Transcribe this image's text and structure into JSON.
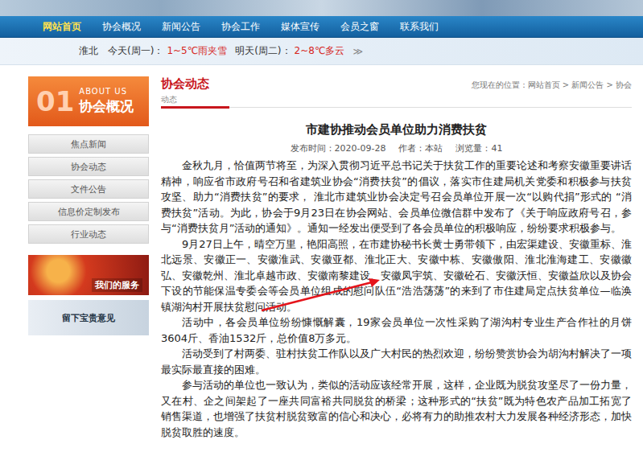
{
  "nav": [
    {
      "label": "网站首页",
      "selected": true
    },
    {
      "label": "协会概况",
      "selected": false
    },
    {
      "label": "新闻公告",
      "selected": false
    },
    {
      "label": "协会工作",
      "selected": false
    },
    {
      "label": "媒体宣传",
      "selected": false
    },
    {
      "label": "会员之窗",
      "selected": false
    },
    {
      "label": "联系我们",
      "selected": false
    }
  ],
  "weather": {
    "city": "淮北",
    "today_label": "今天(周一)：",
    "today": "1~5℃雨夹雪",
    "tomorrow_label": "明天(周二)：",
    "tomorrow": "2~8℃多云",
    "more": "≫"
  },
  "sidebar": {
    "header_en": "ABOUT US",
    "header_num": "01",
    "header_title": "协会概况",
    "items": [
      {
        "label": "焦点新闻",
        "selected": false
      },
      {
        "label": "协会动态",
        "selected": false
      },
      {
        "label": "文件公告",
        "selected": false
      },
      {
        "label": "信息价定制发布",
        "selected": false
      },
      {
        "label": "行业动态",
        "selected": false
      }
    ]
  },
  "promos": [
    {
      "label": "我们的服务"
    },
    {
      "label": "留下宝贵意见"
    }
  ],
  "section": {
    "title": "协会动态",
    "subtitle": "动态",
    "breadcrumb": "您现在的位置：网站首页 > 新闻公告 > 协会"
  },
  "article": {
    "title": "市建协推动会员单位助力消费扶贫",
    "meta": [
      {
        "label": "发布时间：",
        "value": "2020-09-28"
      },
      {
        "label": "作者：",
        "value": "本站"
      },
      {
        "label": "浏览量：",
        "value": "41"
      }
    ],
    "paragraphs": [
      "金秋九月，恰值两节将至，为深入贯彻习近平总书记关于扶贫工作的重要论述和考察安徽重要讲话精神，响应省市政府号召和省建筑业协会“消费扶贫”的倡议，落实市住建局机关党委和积极参与扶贫攻坚、助力“消费扶贫”的要求， 淮北市建筑业协会决定号召会员单位开展一次“以购代捐”形式的 “消费扶贫”活动。为此，协会于9月23日在协会网站、会员单位微信群中发布了《关于响应政府号召，参与“消费扶贫月”活动的通知》。通知一经发出便受到了各会员单位的积极响应，纷纷要求积极参与。",
      "9月27日上午，晴空万里，艳阳高照，在市建协秘书长黄士勇带领下，由宏渠建设、安徽重标、淮北远景、安徽正一、安徽淮武、安徽亚都、淮北正大、安徽中栋、安徽傲阳、淮北淮海建工、安徽徽弘、安徽乾州、淮北卓越市政、安徽南黎建设、安徽凤宇筑、安徽砼石、安徽沃恒、安徽益欣以及协会下设的节能保温专委会等会员单位组成的慰问队伍“浩浩荡荡”的来到了市住建局定点扶贫单位—临涣镇湖沟村开展扶贫慰问活动。",
      "活动中，各会员单位纷纷慷慨解囊，19家会员单位一次性采购了湖沟村专业生产合作社的月饼3604斤、香油1532斤，总价值8万多元。",
      "活动受到了村两委、驻村扶贫工作队以及广大村民的热烈欢迎，纷纷赞赏协会为胡沟村解决了一项最实际最直接的困难。",
      "参与活动的单位也一致认为，类似的活动应该经常开展，这样，企业既为脱贫攻坚尽了一份力量，又在村、企之间架起了一座共同富裕共同脱贫的桥梁；这种形式的“扶贫”既为特色农产品加工拓宽了销售渠道，也增强了扶贫村脱贫致富的信心和决心，必将有力的助推农村大力发展各种经济形态，加快脱贫取胜的速度。"
    ]
  }
}
